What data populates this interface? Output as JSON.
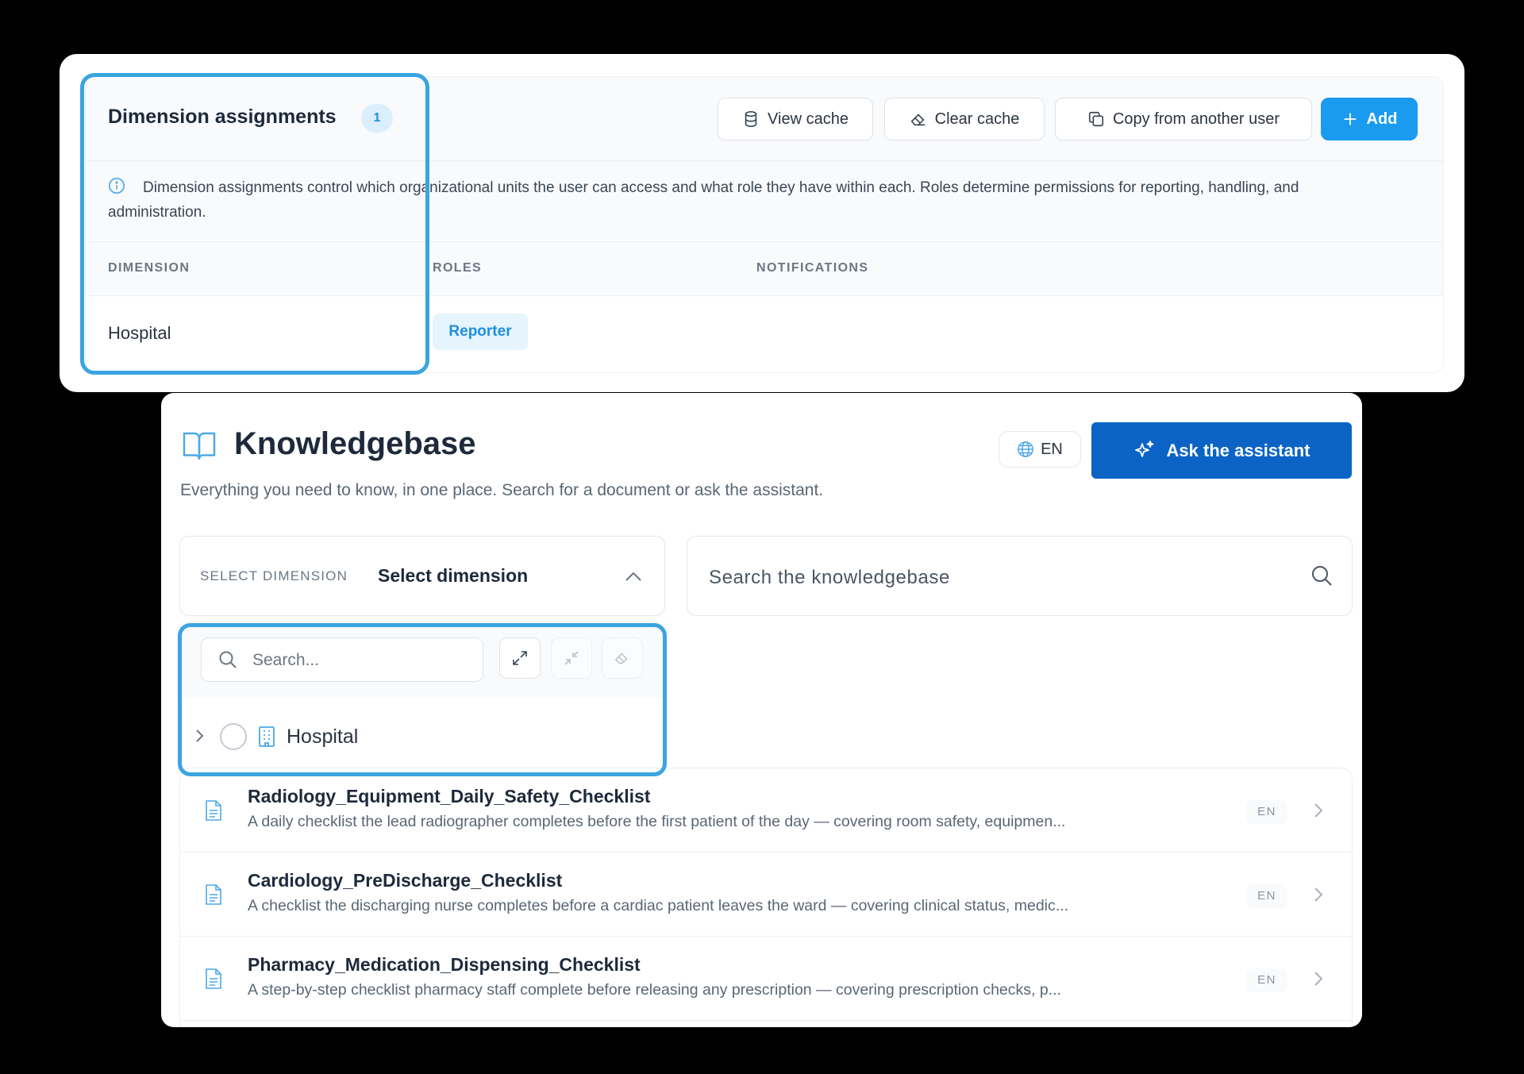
{
  "dimension_assignments": {
    "title": "Dimension assignments",
    "count": "1",
    "buttons": {
      "view_cache": "View cache",
      "clear_cache": "Clear cache",
      "copy_from_user": "Copy from another user",
      "add": "Add"
    },
    "info_text": "Dimension assignments control which organizational units the user can access and what role they have within each. Roles determine permissions for reporting, handling, and administration.",
    "columns": [
      "DIMENSION",
      "ROLES",
      "NOTIFICATIONS"
    ],
    "rows": [
      {
        "dimension": "Hospital",
        "role": "Reporter",
        "notifications": ""
      }
    ]
  },
  "knowledgebase": {
    "title": "Knowledgebase",
    "subtitle": "Everything you need to know, in one place. Search for a document or ask the assistant.",
    "language": "EN",
    "ask_button": "Ask the assistant",
    "select_dimension": {
      "label": "SELECT DIMENSION",
      "value": "Select dimension"
    },
    "search_placeholder": "Search the knowledgebase",
    "dropdown": {
      "search_placeholder": "Search...",
      "items": [
        {
          "label": "Hospital"
        }
      ]
    },
    "documents": [
      {
        "title": "Radiology_Equipment_Daily_Safety_Checklist",
        "description": "A daily checklist the lead radiographer completes before the first patient of the day — covering room safety, equipmen...",
        "language": "EN"
      },
      {
        "title": "Cardiology_PreDischarge_Checklist",
        "description": "A checklist the discharging nurse completes before a cardiac patient leaves the ward — covering clinical status, medic...",
        "language": "EN"
      },
      {
        "title": "Pharmacy_Medication_Dispensing_Checklist",
        "description": "A step-by-step checklist pharmacy staff complete before releasing any prescription — covering prescription checks, p...",
        "language": "EN"
      }
    ]
  },
  "colors": {
    "accent": "#1a9bf0",
    "primary_dark": "#0b64c5",
    "highlight_outline": "#3aa5e0",
    "backdrop": "#000000"
  },
  "icons": [
    "database-icon",
    "eraser-icon",
    "copy-icon",
    "plus-icon",
    "info-icon",
    "book-icon",
    "globe-icon",
    "sparkles-icon",
    "chevron-up-icon",
    "search-icon",
    "expand-icon",
    "collapse-icon",
    "chevron-right-icon",
    "building-icon",
    "document-icon"
  ]
}
